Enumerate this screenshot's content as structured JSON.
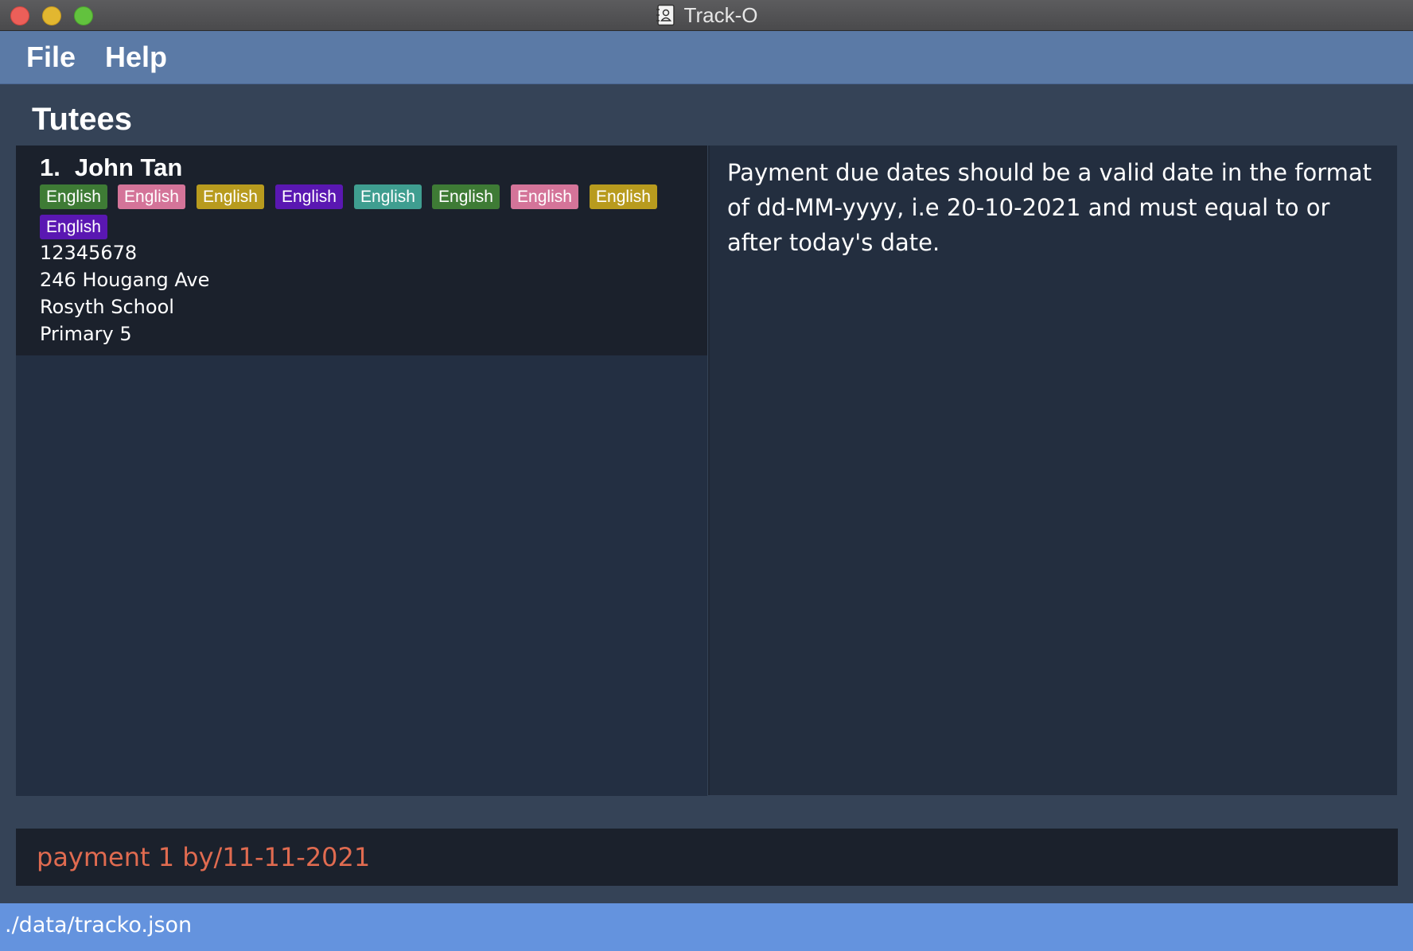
{
  "window": {
    "title": "Track-O"
  },
  "menu": {
    "file_label": "File",
    "help_label": "Help"
  },
  "tutees": {
    "heading": "Tutees",
    "items": [
      {
        "index": "1.",
        "name": "John Tan",
        "tags": [
          {
            "label": "English",
            "color": "#3e7b35"
          },
          {
            "label": "English",
            "color": "#d47499"
          },
          {
            "label": "English",
            "color": "#b89b1e"
          },
          {
            "label": "English",
            "color": "#5a17b2"
          },
          {
            "label": "English",
            "color": "#3f9e90"
          },
          {
            "label": "English",
            "color": "#3e7b35"
          },
          {
            "label": "English",
            "color": "#d47499"
          },
          {
            "label": "English",
            "color": "#b89b1e"
          },
          {
            "label": "English",
            "color": "#5a17b2"
          }
        ],
        "phone": "12345678",
        "address": "246 Hougang Ave",
        "school": "Rosyth School",
        "level": "Primary 5"
      }
    ]
  },
  "result": {
    "message": "Payment due dates should be a valid date in the format of dd-MM-yyyy, i.e 20-10-2021 and must equal to or after today's date."
  },
  "command": {
    "value": "payment 1 by/11-11-2021",
    "color": "#e06b50"
  },
  "status": {
    "file_path": "./data/tracko.json"
  }
}
